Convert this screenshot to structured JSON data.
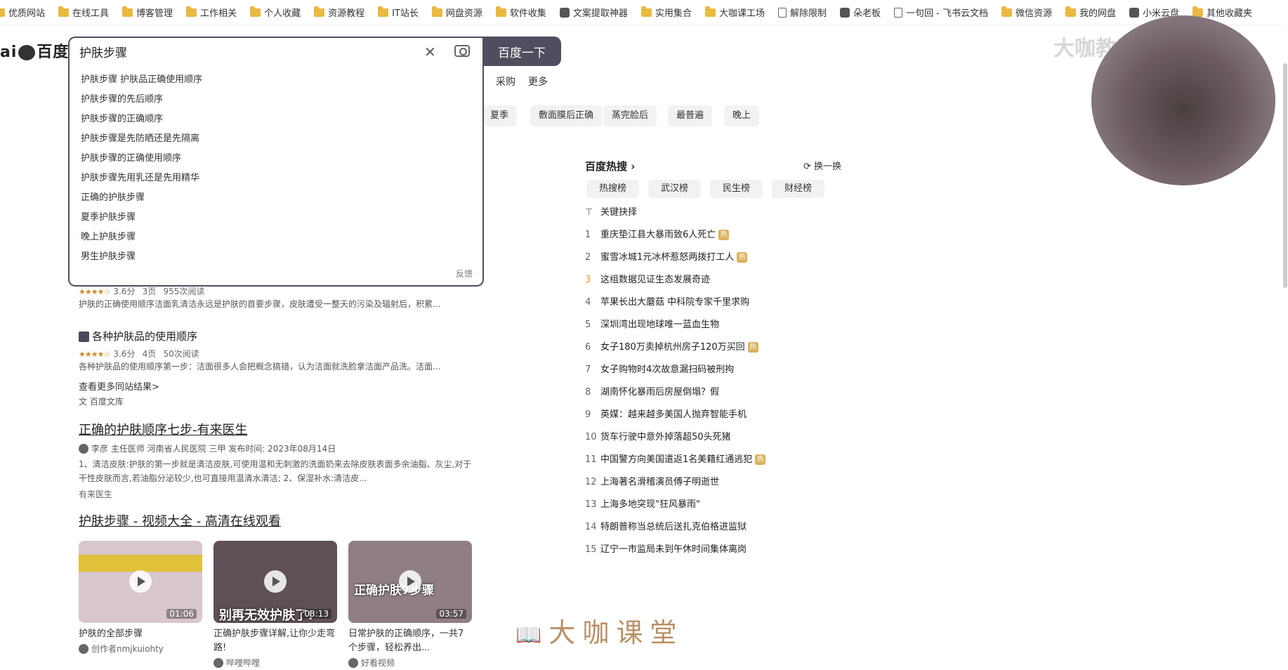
{
  "bookmarks": [
    {
      "label": "优质网站",
      "icon": "folder-icon"
    },
    {
      "label": "在线工具",
      "icon": "folder-icon"
    },
    {
      "label": "博客管理",
      "icon": "folder-icon"
    },
    {
      "label": "工作相关",
      "icon": "folder-icon"
    },
    {
      "label": "个人收藏",
      "icon": "folder-icon"
    },
    {
      "label": "资源教程",
      "icon": "folder-icon"
    },
    {
      "label": "IT站长",
      "icon": "folder-icon"
    },
    {
      "label": "网盘资源",
      "icon": "folder-icon"
    },
    {
      "label": "软件收集",
      "icon": "folder-icon"
    },
    {
      "label": "文案提取神器",
      "icon": "app-icon"
    },
    {
      "label": "实用集合",
      "icon": "folder-icon"
    },
    {
      "label": "大咖课工场",
      "icon": "folder-icon"
    },
    {
      "label": "解除限制",
      "icon": "page-icon"
    },
    {
      "label": "朵老板",
      "icon": "app-icon"
    },
    {
      "label": "一句回 - 飞书云文档",
      "icon": "page-icon"
    },
    {
      "label": "微信资源",
      "icon": "folder-icon"
    },
    {
      "label": "我的网盘",
      "icon": "folder-icon"
    },
    {
      "label": "小米云盘",
      "icon": "app-icon"
    },
    {
      "label": "其他收藏夹",
      "icon": "folder-icon"
    }
  ],
  "logo": {
    "text_left": "ai",
    "text_right": "百度"
  },
  "search": {
    "query": "护肤步骤",
    "button_label": "百度一下",
    "suggestions": [
      "护肤步骤 护肤品正确使用顺序",
      "护肤步骤的先后顺序",
      "护肤步骤的正确顺序",
      "护肤步骤是先防晒还是先隔离",
      "护肤步骤的正确使用顺序",
      "护肤步骤先用乳还是先用精华",
      "正确的护肤步骤",
      "夏季护肤步骤",
      "晚上护肤步骤",
      "男生护肤步骤"
    ],
    "feedback_label": "反馈"
  },
  "tabs": {
    "purchase": "采购",
    "more": "更多"
  },
  "related_tags": [
    "夏季",
    "敷面膜后正确",
    "蒸完脸后",
    "最普遍",
    "晚上"
  ],
  "doc_results": [
    {
      "rating": "3.6分",
      "pages": "3页",
      "reads": "955次阅读",
      "snippet": "护肤的正确使用顺序洁面乳清洁永远是护肤的首要步骤，皮肤遭受一整天的污染及辐射后，积累..."
    },
    {
      "title": "各种护肤品的使用顺序",
      "rating": "3.6分",
      "pages": "4页",
      "reads": "50次阅读",
      "snippet": "各种护肤品的使用顺序第一步：洁面很多人会把概念搞错，认为洁面就洗脸拿洁面产品洗。洁面..."
    }
  ],
  "more_from_site": "查看更多同站结果>",
  "wenku_source": "百度文库",
  "result2": {
    "title": "正确的护肤顺序七步-有来医生",
    "author_line": "李彦 主任医师 河南省人民医院 三甲 发布时间: 2023年08月14日",
    "snippet": "1、清洁皮肤:护肤的第一步就是清洁皮肤,可使用温和无刺激的洗面奶来去除皮肤表面多余油脂、灰尘,对于干性皮肤而言,若油脂分泌较少,也可直接用温清水清洁; 2、保湿补水:清洁皮...",
    "source": "有来医生"
  },
  "video_section": {
    "title": "护肤步骤 - 视频大全 - 高清在线观看",
    "videos": [
      {
        "duration": "01:06",
        "desc": "护肤的全部步骤",
        "source": "创作者nmjkuiohty",
        "thumb_color": "#d8c7cb",
        "banner": "#e2c03a"
      },
      {
        "duration": "03:13",
        "desc": "正确护肤步骤详解,让你少走弯路!",
        "source": "哔哩哔哩",
        "thumb_color": "#5f5058",
        "overlay_text": "别再无效护肤了!"
      },
      {
        "duration": "03:57",
        "desc": "日常护肤的正确顺序，一共7个步骤，轻松养出...",
        "source": "好看视频",
        "thumb_color": "#8f7f85",
        "overlay_text": "正确护肤7步骤"
      }
    ]
  },
  "hot": {
    "title": "百度热搜",
    "refresh_label": "换一换",
    "tabs": [
      "热搜榜",
      "武汉榜",
      "民生榜",
      "财经榜"
    ],
    "pinned": "关键抉择",
    "items": [
      {
        "num": "1",
        "text": "重庆垫江县大暴雨致6人死亡",
        "badge": "热"
      },
      {
        "num": "2",
        "text": "蜜雪冰城1元冰杯惹怒两拨打工人",
        "badge": "热"
      },
      {
        "num": "3",
        "text": "这组数据见证生态发展奇迹",
        "badge": ""
      },
      {
        "num": "4",
        "text": "苹果长出大蘑菇 中科院专家千里求购",
        "badge": ""
      },
      {
        "num": "5",
        "text": "深圳湾出现地球唯一蓝血生物",
        "badge": ""
      },
      {
        "num": "6",
        "text": "女子180万卖掉杭州房子120万买回",
        "badge": "热"
      },
      {
        "num": "7",
        "text": "女子购物时4次故意漏扫码被刑拘",
        "badge": ""
      },
      {
        "num": "8",
        "text": "湖南怀化暴雨后房屋倒塌？假",
        "badge": ""
      },
      {
        "num": "9",
        "text": "英媒：越来越多美国人抛弃智能手机",
        "badge": ""
      },
      {
        "num": "10",
        "text": "货车行驶中意外掉落超50头死猪",
        "badge": ""
      },
      {
        "num": "11",
        "text": "中国警方向美国遣返1名美籍红通逃犯",
        "badge": "热"
      },
      {
        "num": "12",
        "text": "上海著名滑稽演员傅子明逝世",
        "badge": ""
      },
      {
        "num": "13",
        "text": "上海多地突现\"狂风暴雨\"",
        "badge": ""
      },
      {
        "num": "14",
        "text": "特朗普称当总统后送扎克伯格进监狱",
        "badge": ""
      },
      {
        "num": "15",
        "text": "辽宁一市监局未到午休时间集体离岗",
        "badge": ""
      }
    ]
  },
  "watermarks": {
    "top": "大咖教运营",
    "bottom": "大咖课堂"
  }
}
